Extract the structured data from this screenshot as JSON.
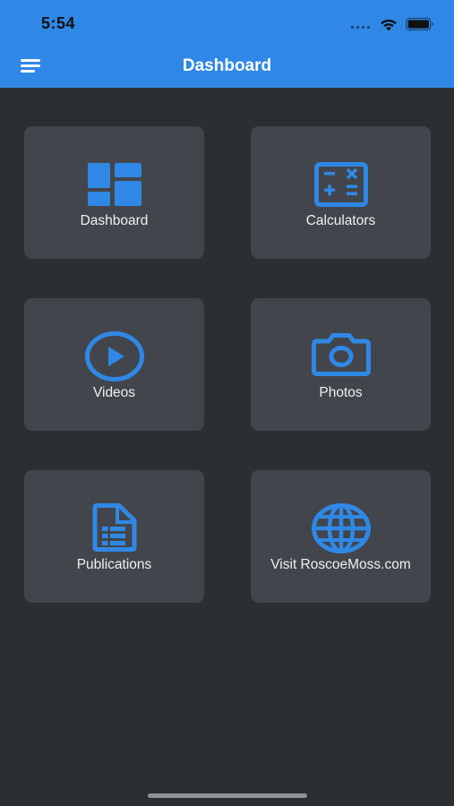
{
  "status_bar": {
    "time": "5:54"
  },
  "app_bar": {
    "title": "Dashboard"
  },
  "tiles": [
    {
      "label": "Dashboard",
      "icon": "dashboard-icon"
    },
    {
      "label": "Calculators",
      "icon": "calculator-icon"
    },
    {
      "label": "Videos",
      "icon": "play-circle-icon"
    },
    {
      "label": "Photos",
      "icon": "camera-icon"
    },
    {
      "label": "Publications",
      "icon": "document-icon"
    },
    {
      "label": "Visit RoscoeMoss.com",
      "icon": "globe-icon"
    }
  ],
  "colors": {
    "app_bar": "#2f88e6",
    "background": "#2b2e32",
    "tile": "#42464c",
    "icon_blue": "#2f88e6",
    "label": "#eef0f2"
  }
}
